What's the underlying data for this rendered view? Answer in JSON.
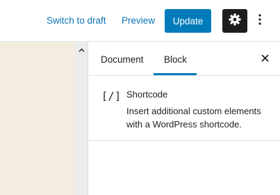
{
  "toolbar": {
    "switch_to_draft_label": "Switch to draft",
    "preview_label": "Preview",
    "update_label": "Update",
    "settings_icon": "gear-icon",
    "more_icon": "vertical-ellipsis-icon"
  },
  "sidebar": {
    "tabs": [
      {
        "label": "Document",
        "active": false
      },
      {
        "label": "Block",
        "active": true
      }
    ],
    "close_icon": "close-icon",
    "block": {
      "icon_text": "[/]",
      "title": "Shortcode",
      "description": "Insert additional custom elements with a WordPress shortcode."
    }
  },
  "colors": {
    "accent": "#007cba",
    "link": "#0a73b4",
    "settings_bg": "#1e1e1e",
    "canvas_bg": "#f3ede0"
  }
}
